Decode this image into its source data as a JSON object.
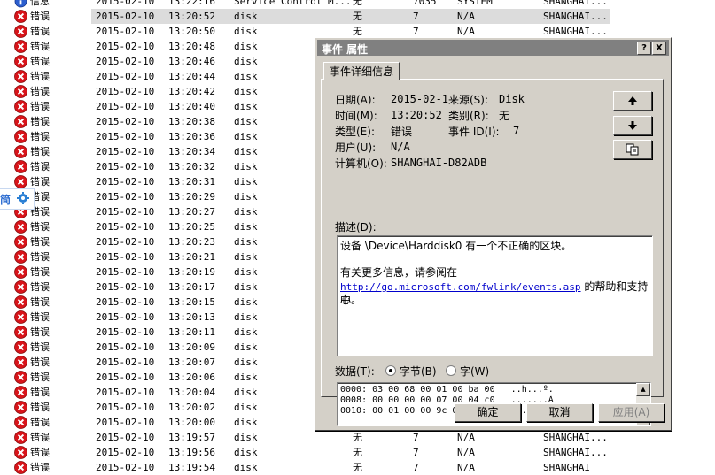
{
  "event_list": {
    "rows": [
      {
        "type": "信息",
        "date": "2015-02-10",
        "time": "13:22:16",
        "source": "Service Control M...",
        "category": "无",
        "event": "7035",
        "user": "SYSTEM",
        "computer": "SHANGHAI...",
        "icon": "info-icon",
        "selected": false
      },
      {
        "type": "错误",
        "date": "2015-02-10",
        "time": "13:20:52",
        "source": "disk",
        "category": "无",
        "event": "7",
        "user": "N/A",
        "computer": "SHANGHAI...",
        "icon": "error-icon",
        "selected": true
      },
      {
        "type": "错误",
        "date": "2015-02-10",
        "time": "13:20:50",
        "source": "disk",
        "category": "无",
        "event": "7",
        "user": "N/A",
        "computer": "SHANGHAI...",
        "icon": "error-icon",
        "selected": false
      },
      {
        "type": "错误",
        "date": "2015-02-10",
        "time": "13:20:48",
        "source": "disk",
        "icon": "error-icon"
      },
      {
        "type": "错误",
        "date": "2015-02-10",
        "time": "13:20:46",
        "source": "disk",
        "icon": "error-icon"
      },
      {
        "type": "错误",
        "date": "2015-02-10",
        "time": "13:20:44",
        "source": "disk",
        "icon": "error-icon"
      },
      {
        "type": "错误",
        "date": "2015-02-10",
        "time": "13:20:42",
        "source": "disk",
        "icon": "error-icon"
      },
      {
        "type": "错误",
        "date": "2015-02-10",
        "time": "13:20:40",
        "source": "disk",
        "icon": "error-icon"
      },
      {
        "type": "错误",
        "date": "2015-02-10",
        "time": "13:20:38",
        "source": "disk",
        "icon": "error-icon"
      },
      {
        "type": "错误",
        "date": "2015-02-10",
        "time": "13:20:36",
        "source": "disk",
        "icon": "error-icon"
      },
      {
        "type": "错误",
        "date": "2015-02-10",
        "time": "13:20:34",
        "source": "disk",
        "icon": "error-icon"
      },
      {
        "type": "错误",
        "date": "2015-02-10",
        "time": "13:20:32",
        "source": "disk",
        "icon": "error-icon"
      },
      {
        "type": "错误",
        "date": "2015-02-10",
        "time": "13:20:31",
        "source": "disk",
        "icon": "error-icon"
      },
      {
        "type": "错误",
        "date": "2015-02-10",
        "time": "13:20:29",
        "source": "disk",
        "icon": "error-icon"
      },
      {
        "type": "错误",
        "date": "2015-02-10",
        "time": "13:20:27",
        "source": "disk",
        "icon": "error-icon"
      },
      {
        "type": "错误",
        "date": "2015-02-10",
        "time": "13:20:25",
        "source": "disk",
        "icon": "error-icon"
      },
      {
        "type": "错误",
        "date": "2015-02-10",
        "time": "13:20:23",
        "source": "disk",
        "icon": "error-icon"
      },
      {
        "type": "错误",
        "date": "2015-02-10",
        "time": "13:20:21",
        "source": "disk",
        "icon": "error-icon"
      },
      {
        "type": "错误",
        "date": "2015-02-10",
        "time": "13:20:19",
        "source": "disk",
        "icon": "error-icon"
      },
      {
        "type": "错误",
        "date": "2015-02-10",
        "time": "13:20:17",
        "source": "disk",
        "icon": "error-icon"
      },
      {
        "type": "错误",
        "date": "2015-02-10",
        "time": "13:20:15",
        "source": "disk",
        "icon": "error-icon"
      },
      {
        "type": "错误",
        "date": "2015-02-10",
        "time": "13:20:13",
        "source": "disk",
        "icon": "error-icon"
      },
      {
        "type": "错误",
        "date": "2015-02-10",
        "time": "13:20:11",
        "source": "disk",
        "icon": "error-icon"
      },
      {
        "type": "错误",
        "date": "2015-02-10",
        "time": "13:20:09",
        "source": "disk",
        "icon": "error-icon"
      },
      {
        "type": "错误",
        "date": "2015-02-10",
        "time": "13:20:07",
        "source": "disk",
        "icon": "error-icon"
      },
      {
        "type": "错误",
        "date": "2015-02-10",
        "time": "13:20:06",
        "source": "disk",
        "icon": "error-icon"
      },
      {
        "type": "错误",
        "date": "2015-02-10",
        "time": "13:20:04",
        "source": "disk",
        "icon": "error-icon"
      },
      {
        "type": "错误",
        "date": "2015-02-10",
        "time": "13:20:02",
        "source": "disk",
        "icon": "error-icon"
      },
      {
        "type": "错误",
        "date": "2015-02-10",
        "time": "13:20:00",
        "source": "disk",
        "icon": "error-icon"
      },
      {
        "type": "错误",
        "date": "2015-02-10",
        "time": "13:19:57",
        "source": "disk",
        "category": "无",
        "event": "7",
        "user": "N/A",
        "computer": "SHANGHAI...",
        "icon": "error-icon"
      },
      {
        "type": "错误",
        "date": "2015-02-10",
        "time": "13:19:56",
        "source": "disk",
        "category": "无",
        "event": "7",
        "user": "N/A",
        "computer": "SHANGHAI...",
        "icon": "error-icon"
      },
      {
        "type": "错误",
        "date": "2015-02-10",
        "time": "13:19:54",
        "source": "disk",
        "category": "无",
        "event": "7",
        "user": "N/A",
        "computer": "SHANGHAI",
        "icon": "error-icon"
      }
    ]
  },
  "side_tool": {
    "label": "简",
    "icon": "gear-icon"
  },
  "dialog": {
    "title": "事件 属性",
    "help_label": "?",
    "close_label": "X",
    "tab_label": "事件详细信息",
    "date_label": "日期(A):",
    "date_value": "2015-02-10",
    "source_label": "来源(S):",
    "source_value": "Disk",
    "time_label": "时间(M):",
    "time_value": "13:20:52",
    "category_label": "类别(R):",
    "category_value": "无",
    "type_label": "类型(E):",
    "type_value": "错误",
    "eventid_label": "事件 ID(I):",
    "eventid_value": "7",
    "user_label": "用户(U):",
    "user_value": "N/A",
    "computer_label": "计算机(O):",
    "computer_value": "SHANGHAI-D82ADB",
    "description_label": "描述(D):",
    "description_line1": "设备 \\Device\\Harddisk0 有一个不正确的区块。",
    "description_line2": "有关更多信息，请参阅在",
    "description_link": "http://go.microsoft.com/fwlink/events.asp",
    "description_line3": "的帮助和支持中",
    "description_line4": "心。",
    "data_label": "数据(T):",
    "radio_bytes": "字节(B)",
    "radio_words": "字(W)",
    "hex_lines": [
      "0000: 03 00 68 00 01 00 ba 00   ..h...º.",
      "0008: 00 00 00 00 07 00 04 c0   .......À",
      "0010: 00 01 00 00 9c 00 00 c0   ....œ..À"
    ],
    "up_icon": "arrow-up-icon",
    "down_icon": "arrow-down-icon",
    "copy_icon": "copy-icon",
    "ok_label": "确定",
    "cancel_label": "取消",
    "apply_label": "应用(A)"
  }
}
